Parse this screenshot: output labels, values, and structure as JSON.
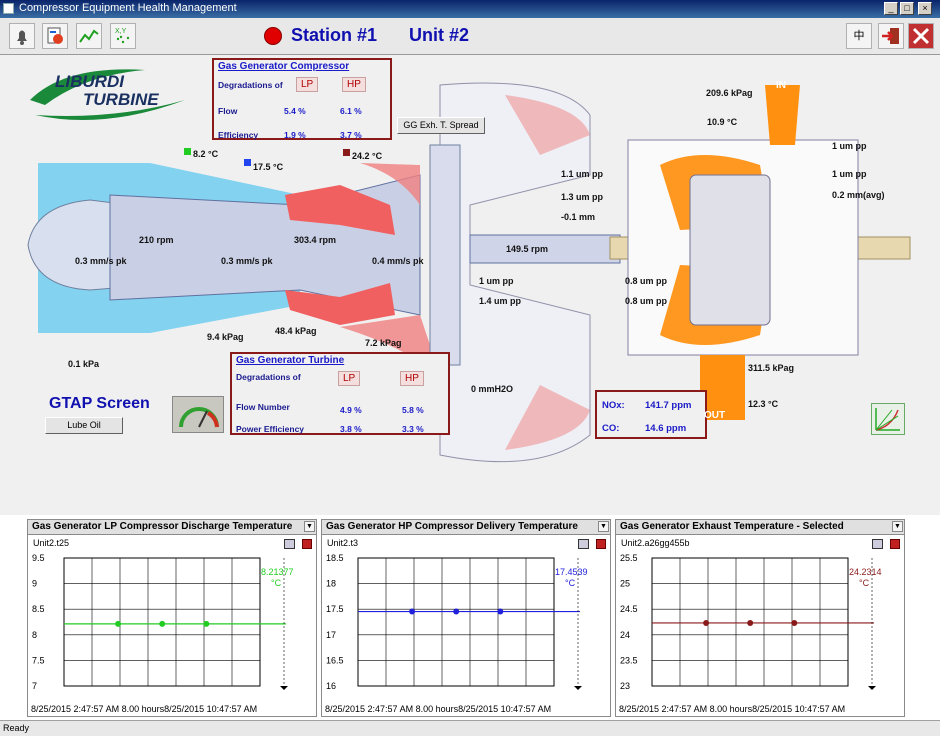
{
  "window": {
    "title": "Compressor Equipment Health Management"
  },
  "toolbar": {
    "station": "Station #1",
    "unit": "Unit #2",
    "lang_label": "中"
  },
  "logo": {
    "line1": "LIBURDI",
    "line2": "TURBINE"
  },
  "compressor_box": {
    "title": "Gas Generator Compressor",
    "degradations_label": "Degradations of",
    "lp": "LP",
    "hp": "HP",
    "rows": [
      {
        "label": "Flow",
        "lp": "5.4 %",
        "hp": "6.1 %"
      },
      {
        "label": "Efficiency",
        "lp": "1.9 %",
        "hp": "3.7 %"
      }
    ]
  },
  "turbine_box": {
    "title": "Gas Generator Turbine",
    "degradations_label": "Degradations of",
    "lp": "LP",
    "hp": "HP",
    "rows": [
      {
        "label": "Flow Number",
        "lp": "4.9 %",
        "hp": "5.8 %"
      },
      {
        "label": "Power Efficiency",
        "lp": "3.8 %",
        "hp": "3.3 %"
      }
    ]
  },
  "emissions_box": {
    "nox_label": "NOx:",
    "nox_value": "141.7 ppm",
    "co_label": "CO:",
    "co_value": "14.6 ppm"
  },
  "buttons": {
    "gg_exh_spread": "GG Exh. T. Spread",
    "lube_oil": "Lube Oil"
  },
  "gtap_label": "GTAP Screen",
  "readings": {
    "t_82": "8.2 °C",
    "t_175": "17.5 °C",
    "t_242": "24.2 °C",
    "rpm_210": "210 rpm",
    "rpm_3034": "303.4 rpm",
    "rpm_1495": "149.5 rpm",
    "vib_03_a": "0.3 mm/s pk",
    "vib_03_b": "0.3 mm/s pk",
    "vib_04": "0.4 mm/s pk",
    "p_01": "0.1 kPa",
    "p_94": "9.4 kPag",
    "p_484": "48.4 kPag",
    "p_72": "7.2 kPag",
    "p_0h2o": "0 mmH2O",
    "um_11": "1.1 um pp",
    "um_13": "1.3 um pp",
    "mm_neg01": "-0.1 mm",
    "um_1a": "1 um pp",
    "um_14": "1.4 um pp",
    "um_08a": "0.8 um pp",
    "um_08b": "0.8 um pp",
    "p_2096": "209.6 kPag",
    "t_109": "10.9 °C",
    "um_1b": "1 um pp",
    "um_1c": "1 um pp",
    "mm_02": "0.2 mm(avg)",
    "p_3115": "311.5 kPag",
    "t_123": "12.3 °C",
    "in_label": "IN",
    "out_label": "OUT"
  },
  "charts": [
    {
      "title": "Gas Generator LP Compressor Discharge Temperature",
      "tag": "Unit2.t25",
      "legend_value": "8.21377",
      "legend_unit": "°C",
      "color": "#22cc22",
      "yticks": [
        "9.5",
        "9",
        "8.5",
        "8",
        "7.5",
        "7"
      ],
      "footer": "8/25/2015 2:47:57 AM  8.00 hours8/25/2015 10:47:57 AM"
    },
    {
      "title": "Gas Generator HP Compressor Delivery Temperature",
      "tag": "Unit2.t3",
      "legend_value": "17.4539",
      "legend_unit": "°C",
      "color": "#2222dd",
      "yticks": [
        "18.5",
        "18",
        "17.5",
        "17",
        "16.5",
        "16"
      ],
      "footer": "8/25/2015 2:47:57 AM  8.00 hours8/25/2015 10:47:57 AM"
    },
    {
      "title": "Gas Generator Exhaust Temperature - Selected",
      "tag": "Unit2.a26gg455b",
      "legend_value": "24.2314",
      "legend_unit": "°C",
      "color": "#8a1a1a",
      "yticks": [
        "25.5",
        "25",
        "24.5",
        "24",
        "23.5",
        "23"
      ],
      "footer": "8/25/2015 2:47:57 AM  8.00 hours8/25/2015 10:47:57 AM"
    }
  ],
  "status": {
    "text": "Ready"
  }
}
